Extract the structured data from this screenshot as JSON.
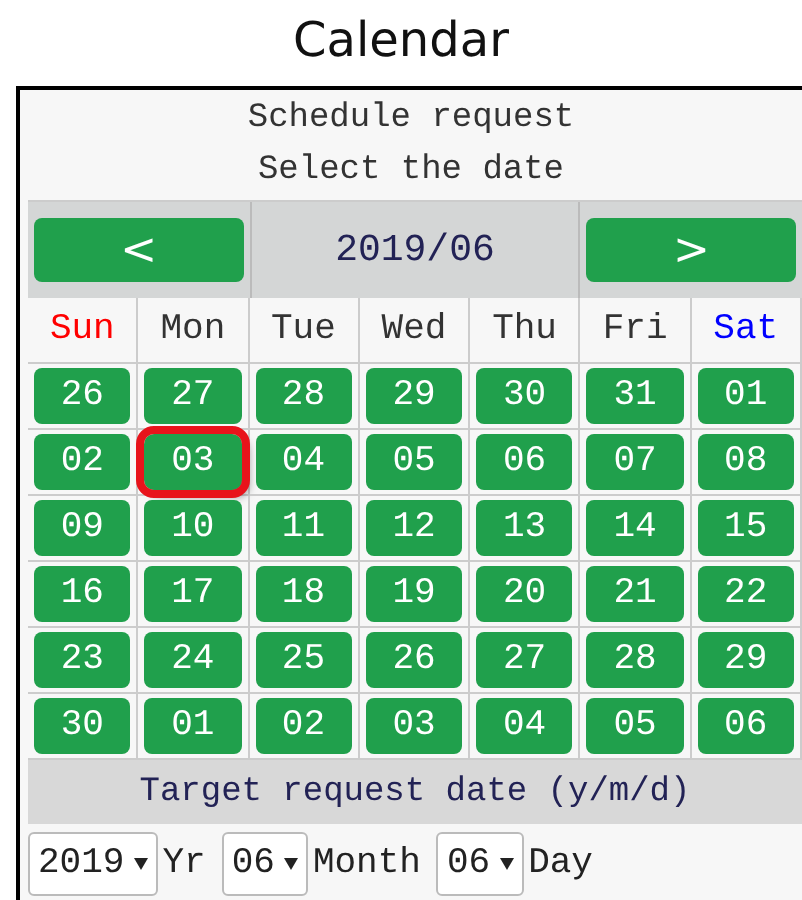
{
  "title": "Calendar",
  "header": {
    "line_1": "Schedule request",
    "line_2": "Select the date"
  },
  "nav": {
    "prev": "<",
    "month": "2019/06",
    "next": ">"
  },
  "weekdays": [
    {
      "label": "Sun",
      "color": "#ff0000"
    },
    {
      "label": "Mon",
      "color": "#333333"
    },
    {
      "label": "Tue",
      "color": "#333333"
    },
    {
      "label": "Wed",
      "color": "#333333"
    },
    {
      "label": "Thu",
      "color": "#333333"
    },
    {
      "label": "Fri",
      "color": "#333333"
    },
    {
      "label": "Sat",
      "color": "#0000ff"
    }
  ],
  "weeks": [
    [
      {
        "label": "26",
        "selected": false
      },
      {
        "label": "27",
        "selected": false
      },
      {
        "label": "28",
        "selected": false
      },
      {
        "label": "29",
        "selected": false
      },
      {
        "label": "30",
        "selected": false
      },
      {
        "label": "31",
        "selected": false
      },
      {
        "label": "01",
        "selected": false
      }
    ],
    [
      {
        "label": "02",
        "selected": false
      },
      {
        "label": "03",
        "selected": true
      },
      {
        "label": "04",
        "selected": false
      },
      {
        "label": "05",
        "selected": false
      },
      {
        "label": "06",
        "selected": false
      },
      {
        "label": "07",
        "selected": false
      },
      {
        "label": "08",
        "selected": false
      }
    ],
    [
      {
        "label": "09",
        "selected": false
      },
      {
        "label": "10",
        "selected": false
      },
      {
        "label": "11",
        "selected": false
      },
      {
        "label": "12",
        "selected": false
      },
      {
        "label": "13",
        "selected": false
      },
      {
        "label": "14",
        "selected": false
      },
      {
        "label": "15",
        "selected": false
      }
    ],
    [
      {
        "label": "16",
        "selected": false
      },
      {
        "label": "17",
        "selected": false
      },
      {
        "label": "18",
        "selected": false
      },
      {
        "label": "19",
        "selected": false
      },
      {
        "label": "20",
        "selected": false
      },
      {
        "label": "21",
        "selected": false
      },
      {
        "label": "22",
        "selected": false
      }
    ],
    [
      {
        "label": "23",
        "selected": false
      },
      {
        "label": "24",
        "selected": false
      },
      {
        "label": "25",
        "selected": false
      },
      {
        "label": "26",
        "selected": false
      },
      {
        "label": "27",
        "selected": false
      },
      {
        "label": "28",
        "selected": false
      },
      {
        "label": "29",
        "selected": false
      }
    ],
    [
      {
        "label": "30",
        "selected": false
      },
      {
        "label": "01",
        "selected": false
      },
      {
        "label": "02",
        "selected": false
      },
      {
        "label": "03",
        "selected": false
      },
      {
        "label": "04",
        "selected": false
      },
      {
        "label": "05",
        "selected": false
      },
      {
        "label": "06",
        "selected": false
      }
    ]
  ],
  "target_label": "Target request date (y/m/d)",
  "date_fields": [
    {
      "value": "2019",
      "unit": "Yr"
    },
    {
      "value": "06",
      "unit": "Month"
    },
    {
      "value": "06",
      "unit": "Day"
    }
  ]
}
